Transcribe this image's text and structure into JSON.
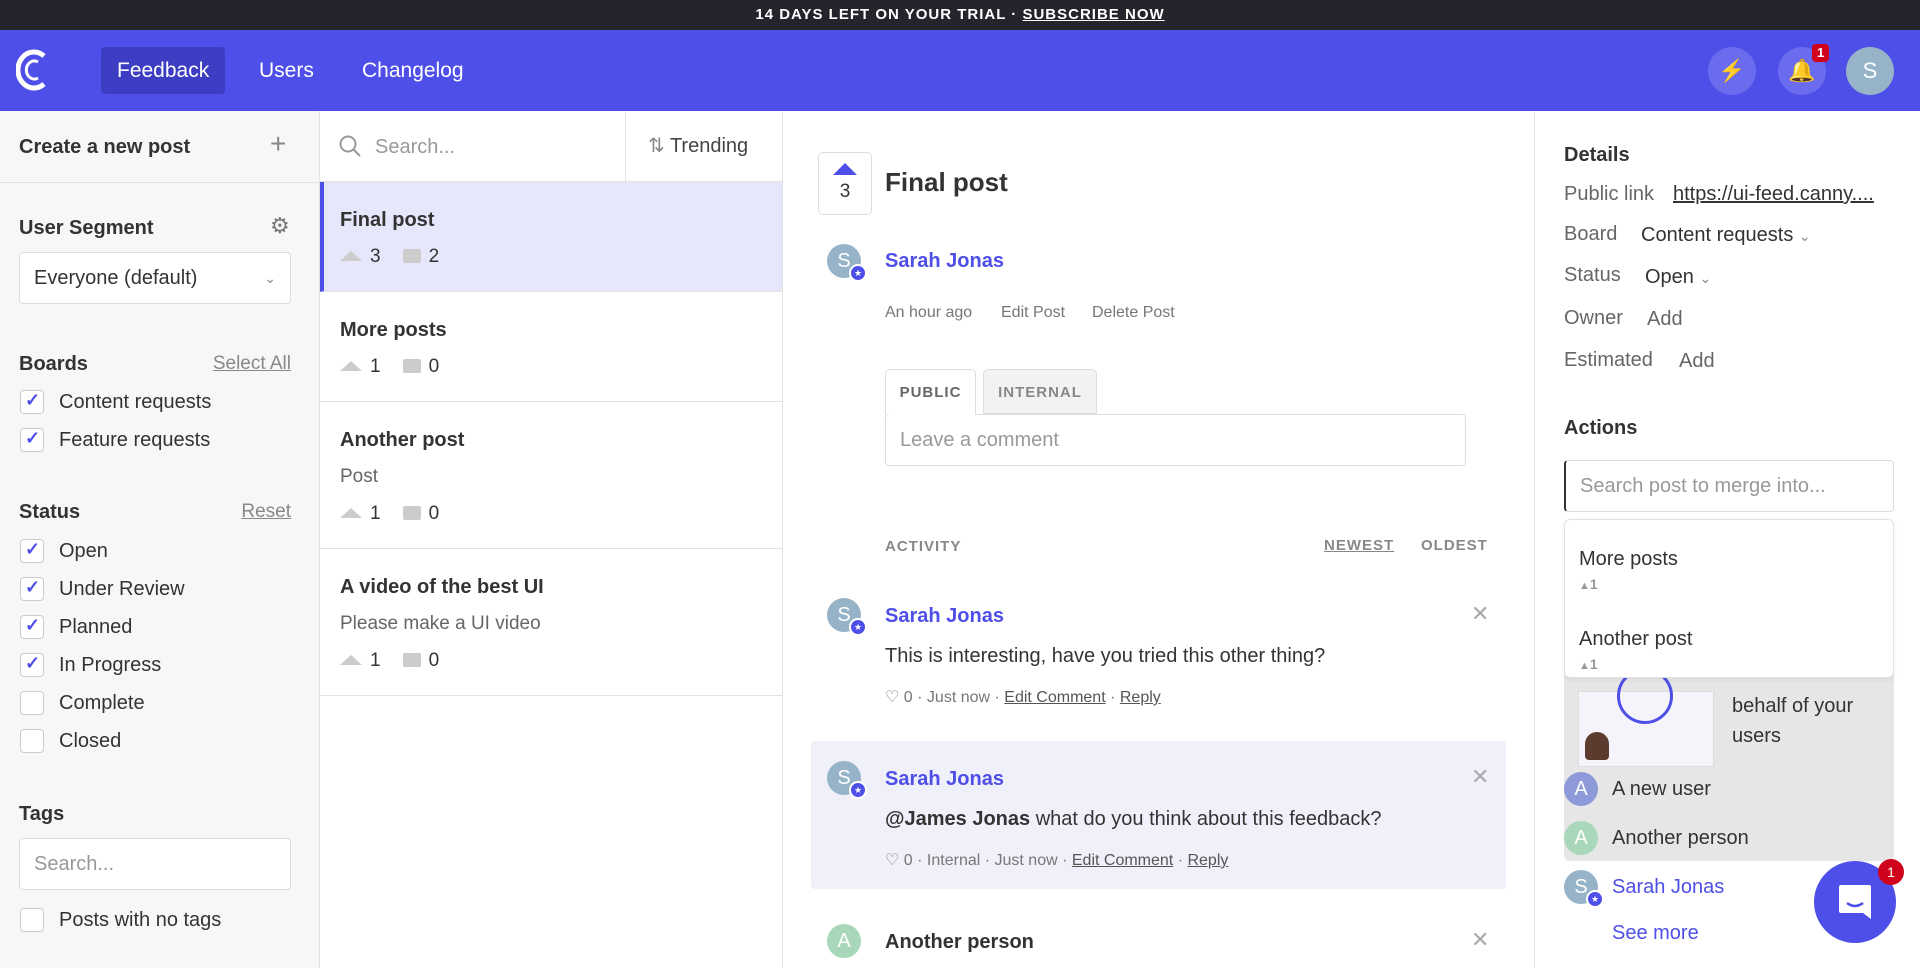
{
  "trial": {
    "text": "14 DAYS LEFT ON YOUR TRIAL · ",
    "link": "SUBSCRIBE NOW"
  },
  "nav": {
    "links": [
      "Feedback",
      "Users",
      "Changelog"
    ],
    "notifications": "1",
    "avatar": "S",
    "accent": "#4e4ee8"
  },
  "left": {
    "create": "Create a new post",
    "segment_title": "User Segment",
    "segment_value": "Everyone (default)",
    "boards_title": "Boards",
    "select_all": "Select All",
    "boards": [
      {
        "label": "Content requests",
        "checked": true
      },
      {
        "label": "Feature requests",
        "checked": true
      }
    ],
    "status_title": "Status",
    "reset": "Reset",
    "statuses": [
      {
        "label": "Open",
        "checked": true
      },
      {
        "label": "Under Review",
        "checked": true
      },
      {
        "label": "Planned",
        "checked": true
      },
      {
        "label": "In Progress",
        "checked": true
      },
      {
        "label": "Complete",
        "checked": false
      },
      {
        "label": "Closed",
        "checked": false
      }
    ],
    "tags_title": "Tags",
    "tags_placeholder": "Search...",
    "no_tags": "Posts with no tags"
  },
  "list": {
    "search_placeholder": "Search...",
    "sort": "Trending",
    "posts": [
      {
        "title": "Final post",
        "desc": "",
        "votes": "3",
        "comments": "2"
      },
      {
        "title": "More posts",
        "desc": "",
        "votes": "1",
        "comments": "0"
      },
      {
        "title": "Another post",
        "desc": "Post",
        "votes": "1",
        "comments": "0"
      },
      {
        "title": "A video of the best UI",
        "desc": "Please make a UI video",
        "votes": "1",
        "comments": "0"
      }
    ]
  },
  "post": {
    "votes": "3",
    "title": "Final post",
    "author": "Sarah Jonas",
    "time": "An hour ago",
    "edit": "Edit Post",
    "delete": "Delete Post",
    "tab_public": "PUBLIC",
    "tab_internal": "INTERNAL",
    "comment_placeholder": "Leave a comment",
    "activity": "ACTIVITY",
    "newest": "NEWEST",
    "oldest": "OLDEST",
    "comments": [
      {
        "author": "Sarah Jonas",
        "mention": "",
        "text": "This is interesting, have you tried this other thing?",
        "likes": "0",
        "meta": " · Just now · ",
        "edit": "Edit Comment",
        "reply": "Reply"
      },
      {
        "author": "Sarah Jonas",
        "mention": "@James Jonas",
        "text": " what do you think about this feedback?",
        "likes": "0",
        "meta": " · Internal · Just now · ",
        "edit": "Edit Comment",
        "reply": "Reply"
      },
      {
        "author": "Another person"
      }
    ]
  },
  "details": {
    "title": "Details",
    "public_link_label": "Public link",
    "public_link": "https://ui-feed.canny....",
    "board_label": "Board",
    "board": "Content requests",
    "status_label": "Status",
    "status": "Open",
    "owner_label": "Owner",
    "owner": "Add",
    "estimated_label": "Estimated",
    "estimated": "Add",
    "actions": "Actions",
    "merge_placeholder": "Search post to merge into...",
    "merge_results": [
      {
        "title": "More posts",
        "votes": "1"
      },
      {
        "title": "Another post",
        "votes": "1"
      }
    ],
    "promo": "behalf of your users",
    "voters": [
      {
        "initial": "A",
        "name": "A new user"
      },
      {
        "initial": "A",
        "name": "Another person"
      },
      {
        "initial": "S",
        "name": "Sarah Jonas"
      }
    ],
    "see_more": "See more",
    "chat_badge": "1"
  }
}
